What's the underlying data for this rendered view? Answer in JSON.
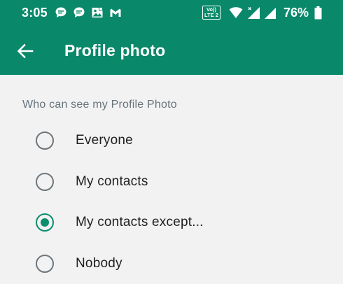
{
  "status_bar": {
    "time": "3:05",
    "volte_line1": "Vo))",
    "volte_line2": "LTE 2",
    "battery": "76%",
    "icons": [
      "message-bubble-icon",
      "message-bubble-icon",
      "photo-icon",
      "gmail-icon",
      "volte-icon",
      "wifi-icon",
      "signal-icon",
      "signal-icon",
      "battery-icon"
    ]
  },
  "toolbar": {
    "back_icon": "arrow-left-icon",
    "title": "Profile photo"
  },
  "privacy": {
    "header": "Who can see my Profile Photo",
    "options": [
      {
        "label": "Everyone",
        "checked": false
      },
      {
        "label": "My contacts",
        "checked": false
      },
      {
        "label": "My contacts except...",
        "checked": true
      },
      {
        "label": "Nobody",
        "checked": false
      }
    ]
  },
  "colors": {
    "app_bar": "#09896a",
    "accent": "#0c8d6c",
    "background": "#f2f2f2",
    "secondary_text": "#67737b"
  }
}
